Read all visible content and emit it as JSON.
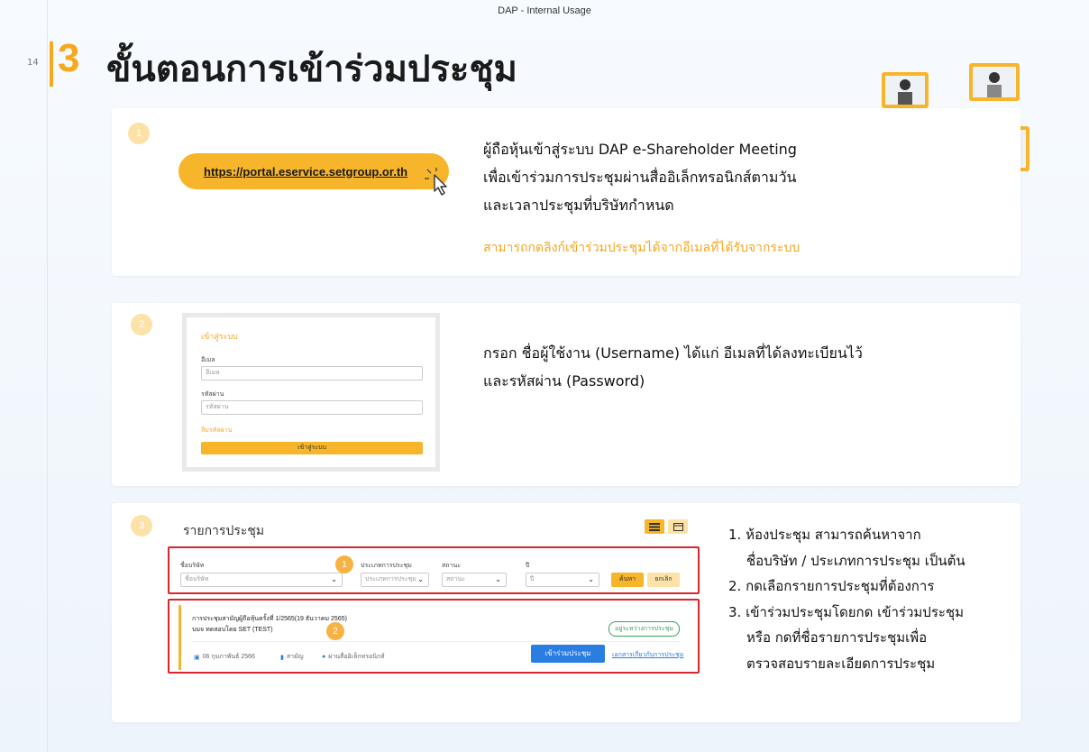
{
  "header": {
    "banner": "DAP - Internal Usage",
    "page_number": "14",
    "section_number": "3",
    "title": "ขั้นตอนการเข้าร่วมประชุม"
  },
  "colors": {
    "accent": "#f7a81b",
    "highlight_box": "#d9262c",
    "join_button": "#2a7de1"
  },
  "step1": {
    "badge": "1",
    "url": "https://portal.eservice.setgroup.or.th",
    "desc_lines": [
      "ผู้ถือหุ้นเข้าสู่ระบบ DAP e-Shareholder Meeting",
      "เพื่อเข้าร่วมการประชุมผ่านสื่ออิเล็กทรอนิกส์ตามวัน",
      "และเวลาประชุมที่บริษัทกำหนด"
    ],
    "note": "สามารถกดลิงก์เข้าร่วมประชุมได้จากอีเมลที่ได้รับจากระบบ"
  },
  "step2": {
    "badge": "2",
    "login": {
      "title": "เข้าสู่ระบบ",
      "email_label": "อีเมล",
      "email_placeholder": "อีเมล",
      "password_label": "รหัสผ่าน",
      "password_placeholder": "รหัสผ่าน",
      "forgot": "ลืมรหัสผ่าน",
      "submit": "เข้าสู่ระบบ"
    },
    "desc_lines": [
      "กรอก ชื่อผู้ใช้งาน (Username) ได้แก่ อีเมลที่ได้ลงทะเบียนไว้",
      "และรหัสผ่าน (Password)"
    ]
  },
  "step3": {
    "badge": "3",
    "list_title": "รายการประชุม",
    "filters": {
      "company_label": "ชื่อบริษัท",
      "company_placeholder": "ชื่อบริษัท",
      "type_label": "ประเภทการประชุม",
      "type_placeholder": "ประเภทการประชุม",
      "status_label": "สถานะ",
      "status_placeholder": "สถานะ",
      "year_label": "ปี",
      "year_placeholder": "ปี",
      "search": "ค้นหา",
      "cancel": "ยกเลิก"
    },
    "meeting": {
      "name": "การประชุมสามัญผู้ถือหุ้นครั้งที่ 1/2565(19 ธันวาคม 2565)",
      "company": "บมจ ทดสอบโดย SET (TEST)",
      "status": "อยู่ระหว่างการประชุม",
      "date": "06 กุมภาพันธ์ 2566",
      "type": "สามัญ",
      "location": "ผ่านสื่ออิเล็กทรอนิกส์",
      "join": "เข้าร่วมประชุม",
      "doc_link": "เอกสารเกี่ยวกับการประชุม"
    },
    "overlay_badges": [
      "1",
      "2"
    ],
    "instructions": {
      "l1": "1. ห้องประชุม สามารถค้นหาจาก",
      "l1b": "ชื่อบริษัท / ประเภทการประชุม เป็นต้น",
      "l2": "2. กดเลือกรายการประชุมที่ต้องการ",
      "l3": "3. เข้าร่วมประชุมโดยกด เข้าร่วมประชุม",
      "l3b": "หรือ กดที่ชื่อรายการประชุมเพื่อ",
      "l3c": "ตรวจสอบรายละเอียดการประชุม"
    }
  }
}
